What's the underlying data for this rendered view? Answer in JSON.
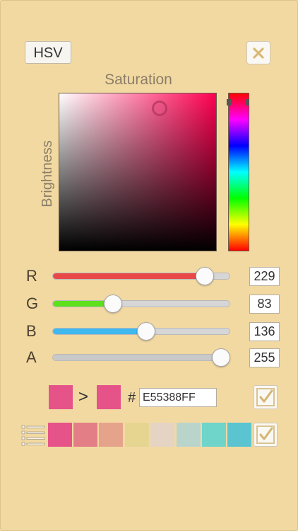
{
  "picker": {
    "mode_label": "HSV",
    "saturation_label": "Saturation",
    "brightness_label": "Brightness"
  },
  "channels": [
    {
      "label": "R",
      "value": "229",
      "fraction": 0.898,
      "color": "#e84848"
    },
    {
      "label": "G",
      "value": "83",
      "fraction": 0.325,
      "color": "#5ee01c"
    },
    {
      "label": "B",
      "value": "136",
      "fraction": 0.533,
      "color": "#3fb8ee"
    },
    {
      "label": "A",
      "value": "255",
      "fraction": 1.0,
      "color": "#c9c9c9"
    }
  ],
  "preview": {
    "old_color": "#e55388",
    "new_color": "#e55388",
    "arrow": ">",
    "hash": "#",
    "hex_value": "E55388FF"
  },
  "palette": [
    "#e55388",
    "#e47e86",
    "#e6a38b",
    "#e6d590",
    "#e5d3c4",
    "#b9d5cb",
    "#6fd4c9",
    "#5ac5d1"
  ],
  "icons": {
    "close": "close-icon",
    "check": "check-icon",
    "list": "list-icon"
  }
}
